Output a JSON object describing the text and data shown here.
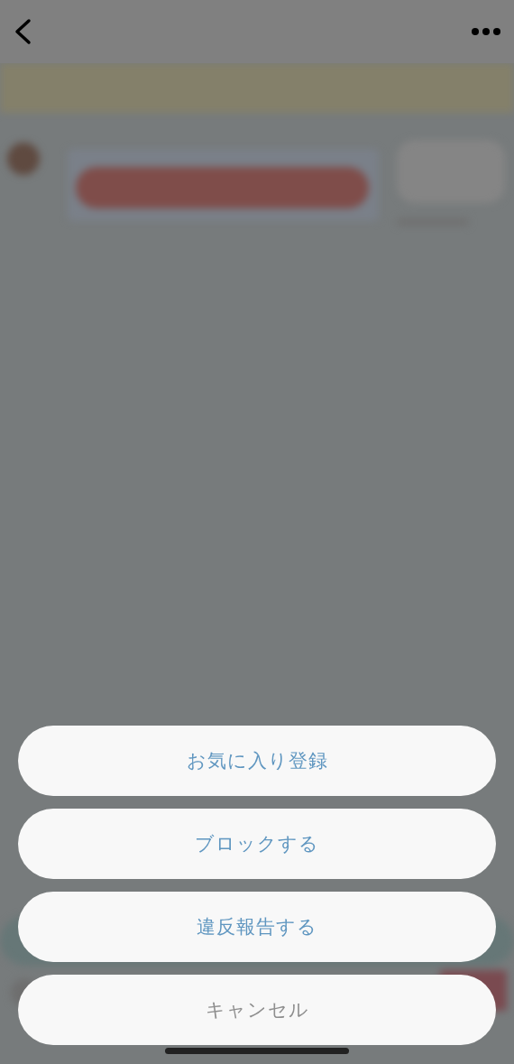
{
  "action_sheet": {
    "actions": [
      {
        "label": "お気に入り登録",
        "kind": "action"
      },
      {
        "label": "ブロックする",
        "kind": "action"
      },
      {
        "label": "違反報告する",
        "kind": "action"
      },
      {
        "label": "キャンセル",
        "kind": "cancel"
      }
    ]
  }
}
